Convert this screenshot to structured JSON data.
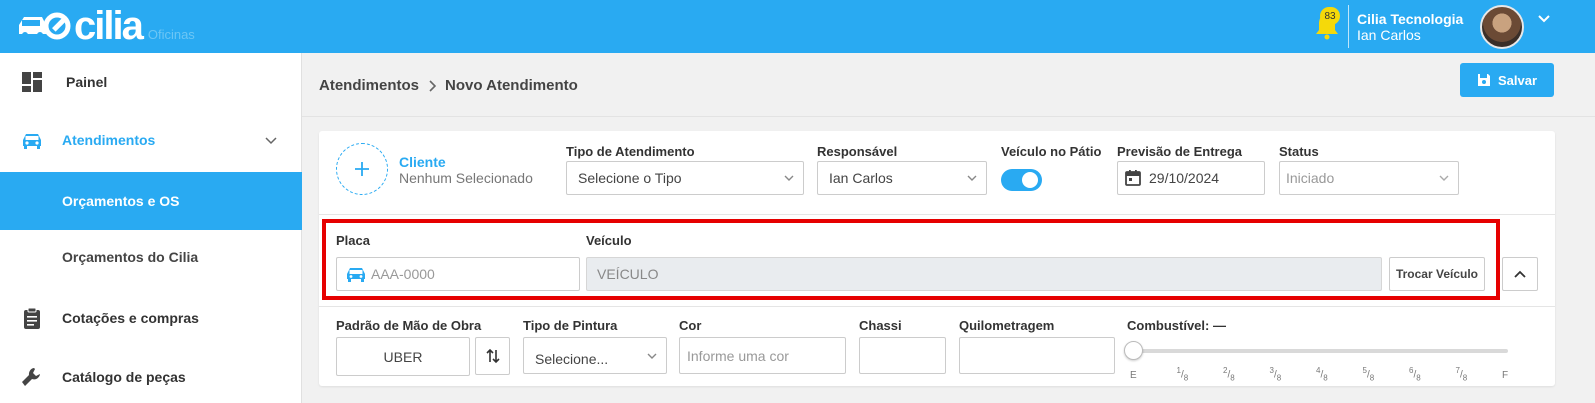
{
  "topbar": {
    "brand": "cilia",
    "brand_sub": "Oficinas",
    "notifications_count": "83",
    "company": "Cilia Tecnologia",
    "user": "Ian Carlos"
  },
  "sidebar": {
    "items": [
      {
        "label": "Painel"
      },
      {
        "label": "Atendimentos"
      },
      {
        "label": "Orçamentos e OS"
      },
      {
        "label": "Orçamentos do Cilia"
      },
      {
        "label": "Cotações e compras"
      },
      {
        "label": "Catálogo de peças"
      }
    ]
  },
  "breadcrumb": [
    "Atendimentos",
    "Novo Atendimento"
  ],
  "save_label": "Salvar",
  "client": {
    "title": "Cliente",
    "subtitle": "Nenhum Selecionado"
  },
  "form": {
    "tipo_label": "Tipo de Atendimento",
    "tipo_value": "Selecione o Tipo",
    "responsavel_label": "Responsável",
    "responsavel_value": "Ian Carlos",
    "patio_label": "Veículo no Pátio",
    "patio_on": true,
    "previsao_label": "Previsão de Entrega",
    "previsao_value": "29/10/2024",
    "status_label": "Status",
    "status_value": "Iniciado",
    "placa_label": "Placa",
    "placa_placeholder": "AAA-0000",
    "veiculo_label": "Veículo",
    "veiculo_value": "VEÍCULO",
    "trocar_label": "Trocar Veículo",
    "mao_obra_label": "Padrão de Mão de Obra",
    "mao_obra_value": "UBER",
    "pintura_label": "Tipo de Pintura",
    "pintura_value": "Selecione...",
    "cor_label": "Cor",
    "cor_placeholder": "Informe uma cor",
    "chassi_label": "Chassi",
    "chassi_value": "",
    "km_label": "Quilometragem",
    "km_value": "",
    "combustivel_label": "Combustível: —",
    "combustivel_level": 0,
    "combustivel_ticks": [
      "E",
      "1/8",
      "2/8",
      "3/8",
      "4/8",
      "5/8",
      "6/8",
      "7/8",
      "F"
    ]
  },
  "colors": {
    "accent": "#29aaf2",
    "highlight": "#e60000"
  }
}
